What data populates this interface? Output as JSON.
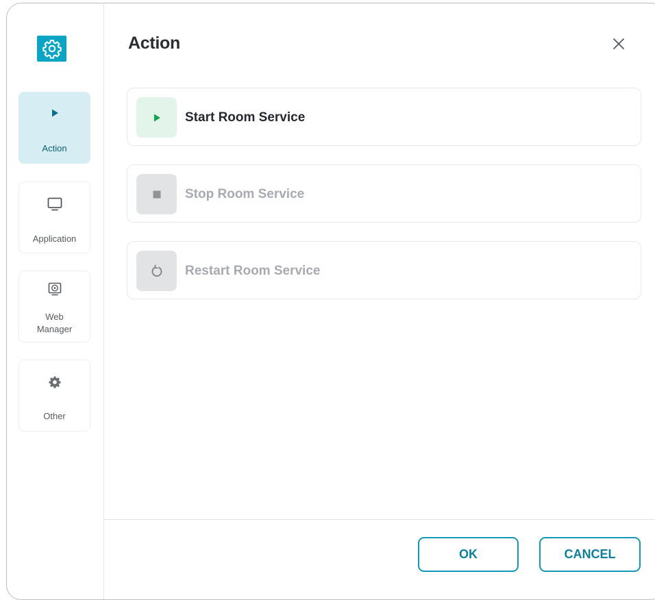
{
  "dialog": {
    "title": "Action",
    "close_icon": "close-icon"
  },
  "app_logo": {
    "icon": "gear-icon",
    "color": "#0aa5c4"
  },
  "sidebar": {
    "items": [
      {
        "label": "Action",
        "icon": "play-icon",
        "active": true
      },
      {
        "label": "Application",
        "icon": "monitor-icon",
        "active": false
      },
      {
        "label": "Web\nManager",
        "icon": "web-manager-icon",
        "active": false
      },
      {
        "label": "Other",
        "icon": "gear-icon",
        "active": false
      }
    ]
  },
  "actions": [
    {
      "label": "Start Room Service",
      "icon": "play-icon",
      "enabled": true,
      "icon_color": "#18a04f"
    },
    {
      "label": "Stop Room Service",
      "icon": "stop-icon",
      "enabled": false,
      "icon_color": "#909398"
    },
    {
      "label": "Restart Room Service",
      "icon": "restart-icon",
      "enabled": false,
      "icon_color": "#7d8085"
    }
  ],
  "footer": {
    "ok_label": "OK",
    "cancel_label": "CANCEL",
    "accent_color": "#1498b6"
  }
}
